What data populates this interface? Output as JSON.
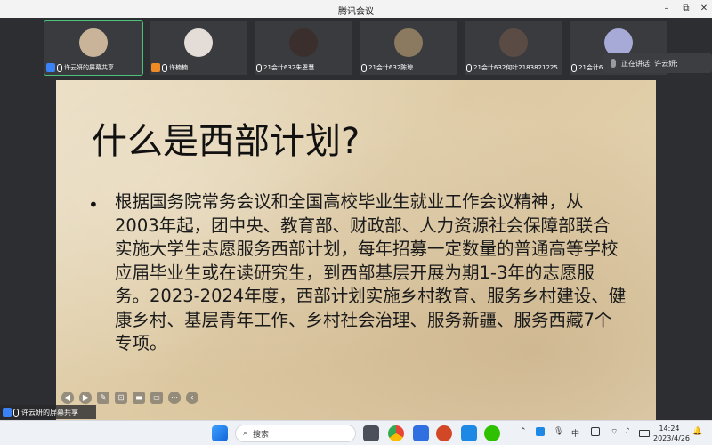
{
  "window": {
    "title": "腾讯会议",
    "minimize": "–",
    "restore": "⧉",
    "close": "✕"
  },
  "participants": [
    {
      "name": "许云妍的屏幕共享",
      "avatar_color": "#c9b49a",
      "badge": "blue",
      "active": true
    },
    {
      "name": "许楠楠",
      "avatar_color": "#e4dcd6",
      "badge": "orange",
      "active": false
    },
    {
      "name": "21会计632朱恩慧",
      "avatar_color": "#3a2f2c",
      "badge": "none",
      "active": false
    },
    {
      "name": "21会计632陈琼",
      "avatar_color": "#8c7a60",
      "badge": "none",
      "active": false
    },
    {
      "name": "21会计632何叶2183821225",
      "avatar_color": "#5a4b44",
      "badge": "none",
      "active": false
    },
    {
      "name": "21会计632",
      "avatar_color": "#a7a9d6",
      "badge": "none",
      "active": false
    }
  ],
  "speaking": {
    "label": "正在讲话: 许云妍;"
  },
  "slide": {
    "title": "什么是西部计划?",
    "bullet": "•",
    "body": "根据国务院常务会议和全国高校毕业生就业工作会议精神，从2003年起，团中央、教育部、财政部、人力资源社会保障部联合实施大学生志愿服务西部计划，每年招募一定数量的普通高等学校应届毕业生或在读研究生，到西部基层开展为期1-3年的志愿服务。2023-2024年度，西部计划实施乡村教育、服务乡村建设、健康乡村、基层青年工作、乡村社会治理、服务新疆、服务西藏7个专项。"
  },
  "slide_tools": [
    {
      "icon": "prev-slide-icon",
      "glyph": "◀"
    },
    {
      "icon": "next-slide-icon",
      "glyph": "▶"
    },
    {
      "icon": "pen-icon",
      "glyph": "✎"
    },
    {
      "icon": "zoom-icon",
      "glyph": "⊡"
    },
    {
      "icon": "slides-icon",
      "glyph": "▬"
    },
    {
      "icon": "comment-icon",
      "glyph": "▭"
    },
    {
      "icon": "more-icon",
      "glyph": "⋯"
    },
    {
      "icon": "collapse-icon",
      "glyph": "‹"
    }
  ],
  "share_tag": {
    "label": "许云妍的屏幕共享"
  },
  "taskbar": {
    "search_placeholder": "搜索",
    "ime": "中",
    "clock_time": "14:24",
    "clock_date": "2023/4/26"
  },
  "colors": {
    "accent_green": "#4cc27d",
    "badge_blue": "#3b82f6",
    "badge_orange": "#f08a24"
  }
}
